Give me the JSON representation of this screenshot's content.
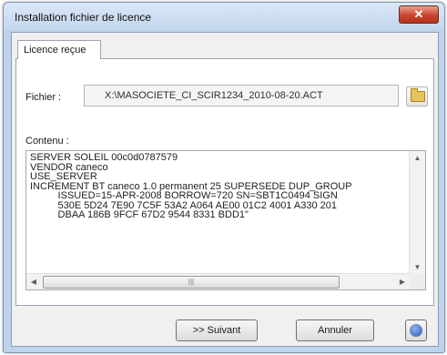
{
  "window": {
    "title": "Installation fichier de licence",
    "close_glyph": "✕"
  },
  "tabs": [
    {
      "label": "Licence reçue",
      "active": true
    }
  ],
  "file": {
    "label": "Fichier :",
    "value": "X:\\MASOCIETE_CI_SCIR1234_2010-08-20.ACT",
    "browse_icon": "folder-icon"
  },
  "content": {
    "label": "Contenu :",
    "text": "SERVER SOLEIL 00c0d0787579\nVENDOR caneco\nUSE_SERVER\nINCREMENT BT caneco 1.0 permanent 25 SUPERSEDE DUP_GROUP\n          ISSUED=15-APR-2008 BORROW=720 SN=SBT1C0494 SIGN\n          530E 5D24 7E90 7C5F 53A2 A064 AE00 01C2 4001 A330 201\n          DBAA 186B 9FCF 67D2 9544 8331 BDD1\""
  },
  "buttons": {
    "next": ">> Suivant",
    "cancel": "Annuler",
    "help_icon": "help-icon"
  },
  "scrollbar": {
    "thumb_grip": "|||",
    "up": "▲",
    "down": "▼",
    "left": "◀",
    "right": "▶"
  }
}
